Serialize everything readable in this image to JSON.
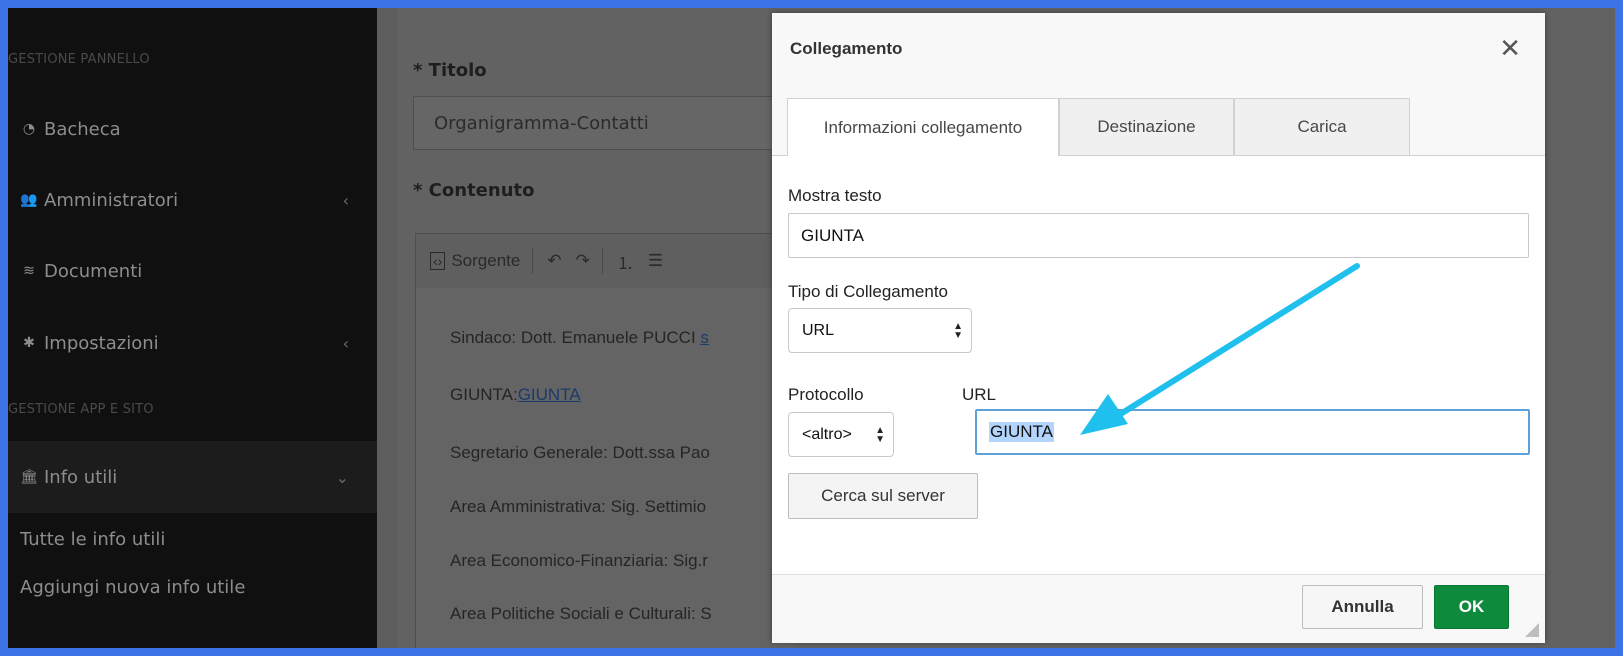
{
  "sidebar": {
    "section_panel": "GESTIONE PANNELLO",
    "section_app": "GESTIONE APP E SITO",
    "items": [
      {
        "label": "Bacheca",
        "icon": "dashboard-icon"
      },
      {
        "label": "Amministratori",
        "icon": "users-icon"
      },
      {
        "label": "Documenti",
        "icon": "layers-icon"
      },
      {
        "label": "Impostazioni",
        "icon": "gear-icon"
      },
      {
        "label": "Info utili",
        "icon": "institution-icon"
      }
    ],
    "subitems": [
      "Tutte le info utili",
      "Aggiungi nuova info utile"
    ]
  },
  "form": {
    "title_label": "* Titolo",
    "title_value": "Organigramma-Contatti",
    "content_label": "* Contenuto",
    "toolbar_source": "Sorgente",
    "lines": [
      "Sindaco: Dott. Emanuele PUCCI",
      "GIUNTA:",
      "Segretario Generale: Dott.ssa Pao",
      "Area Amministrativa: Sig. Settimio",
      "Area Economico-Finanziaria: Sig.r",
      "Area Politiche Sociali e Culturali: S"
    ],
    "link_fragment": "s",
    "giunta_link": "GIUNTA"
  },
  "dialog": {
    "title": "Collegamento",
    "tabs": [
      "Informazioni collegamento",
      "Destinazione",
      "Carica"
    ],
    "display_text_label": "Mostra testo",
    "display_text_value": "GIUNTA",
    "link_type_label": "Tipo di Collegamento",
    "link_type_value": "URL",
    "protocol_label": "Protocollo",
    "protocol_value": "<altro>",
    "url_label": "URL",
    "url_value": "GIUNTA",
    "browse_server": "Cerca sul server",
    "cancel": "Annulla",
    "ok": "OK"
  },
  "colors": {
    "ok_button": "#0d8a3c",
    "annotation_arrow": "#1fc0ee",
    "screen_border": "#3b73e6"
  }
}
